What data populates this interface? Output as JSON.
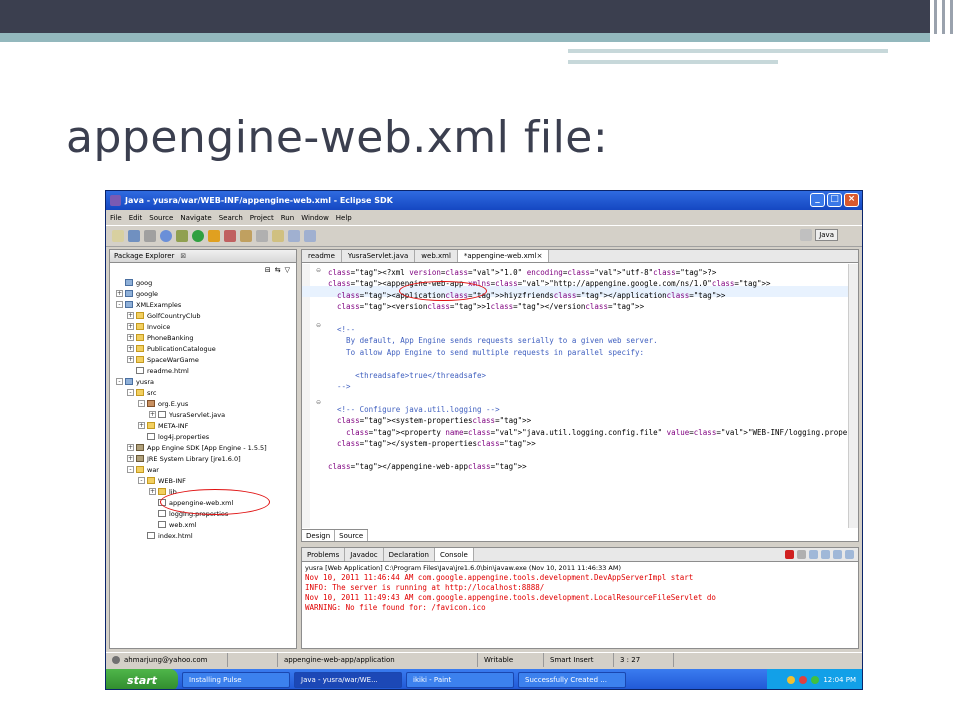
{
  "slide": {
    "title": "appengine-web.xml file:"
  },
  "window": {
    "title": "Java - yusra/war/WEB-INF/appengine-web.xml - Eclipse SDK",
    "menu": [
      "File",
      "Edit",
      "Source",
      "Navigate",
      "Search",
      "Project",
      "Run",
      "Window",
      "Help"
    ],
    "perspective": "Java"
  },
  "package_explorer": {
    "title": "Package Explorer",
    "items": [
      {
        "label": "goog",
        "icon": "proj",
        "depth": 0,
        "exp": ""
      },
      {
        "label": "google",
        "icon": "proj",
        "depth": 0,
        "exp": "+"
      },
      {
        "label": "XMLExamples",
        "icon": "proj",
        "depth": 0,
        "exp": "-"
      },
      {
        "label": "GolfCountryClub",
        "icon": "folder",
        "depth": 1,
        "exp": "+"
      },
      {
        "label": "Invoice",
        "icon": "folder",
        "depth": 1,
        "exp": "+"
      },
      {
        "label": "PhoneBanking",
        "icon": "folder",
        "depth": 1,
        "exp": "+"
      },
      {
        "label": "PublicationCatalogue",
        "icon": "folder",
        "depth": 1,
        "exp": "+"
      },
      {
        "label": "SpaceWarGame",
        "icon": "folder",
        "depth": 1,
        "exp": "+"
      },
      {
        "label": "readme.html",
        "icon": "file",
        "depth": 1,
        "exp": ""
      },
      {
        "label": "yusra",
        "icon": "proj",
        "depth": 0,
        "exp": "-"
      },
      {
        "label": "src",
        "icon": "folder",
        "depth": 1,
        "exp": "-"
      },
      {
        "label": "org.E.yus",
        "icon": "pkg",
        "depth": 2,
        "exp": "-"
      },
      {
        "label": "YusraServlet.java",
        "icon": "file",
        "depth": 3,
        "exp": "+"
      },
      {
        "label": "META-INF",
        "icon": "folder",
        "depth": 2,
        "exp": "+"
      },
      {
        "label": "log4j.properties",
        "icon": "file",
        "depth": 2,
        "exp": ""
      },
      {
        "label": "App Engine SDK [App Engine - 1.5.5]",
        "icon": "lib",
        "depth": 1,
        "exp": "+"
      },
      {
        "label": "JRE System Library [jre1.6.0]",
        "icon": "lib",
        "depth": 1,
        "exp": "+"
      },
      {
        "label": "war",
        "icon": "folder",
        "depth": 1,
        "exp": "-"
      },
      {
        "label": "WEB-INF",
        "icon": "folder",
        "depth": 2,
        "exp": "-"
      },
      {
        "label": "lib",
        "icon": "folder",
        "depth": 3,
        "exp": "+"
      },
      {
        "label": "appengine-web.xml",
        "icon": "file",
        "depth": 3,
        "exp": ""
      },
      {
        "label": "logging.properties",
        "icon": "file",
        "depth": 3,
        "exp": ""
      },
      {
        "label": "web.xml",
        "icon": "file",
        "depth": 3,
        "exp": ""
      },
      {
        "label": "index.html",
        "icon": "file",
        "depth": 2,
        "exp": ""
      }
    ]
  },
  "editor": {
    "tabs": [
      "readme",
      "YusraServlet.java",
      "web.xml",
      "*appengine-web.xml"
    ],
    "bottom_tabs": [
      "Design",
      "Source"
    ],
    "lines": [
      {
        "text": "<?xml version=\"1.0\" encoding=\"utf-8\"?>"
      },
      {
        "text": "<appengine-web-app xmlns=\"http://appengine.google.com/ns/1.0\">"
      },
      {
        "text": "  <application>hiyzfriends</application>"
      },
      {
        "text": "  <version>1</version>"
      },
      {
        "text": ""
      },
      {
        "text": "  <!--"
      },
      {
        "text": "    By default, App Engine sends requests serially to a given web server."
      },
      {
        "text": "    To allow App Engine to send multiple requests in parallel specify:"
      },
      {
        "text": ""
      },
      {
        "text": "      <threadsafe>true</threadsafe>"
      },
      {
        "text": "  -->"
      },
      {
        "text": ""
      },
      {
        "text": "  <!-- Configure java.util.logging -->"
      },
      {
        "text": "  <system-properties>"
      },
      {
        "text": "    <property name=\"java.util.logging.config.file\" value=\"WEB-INF/logging.properties\"/"
      },
      {
        "text": "  </system-properties>"
      },
      {
        "text": ""
      },
      {
        "text": "</appengine-web-app>"
      }
    ]
  },
  "console": {
    "tabs": [
      "Problems",
      "Javadoc",
      "Declaration",
      "Console"
    ],
    "header": "yusra [Web Application] C:\\Program Files\\Java\\jre1.6.0\\bin\\javaw.exe (Nov 10, 2011 11:46:33 AM)",
    "lines": [
      "Nov 10, 2011 11:46:44 AM com.google.appengine.tools.development.DevAppServerImpl start",
      "INFO: The server is running at http://localhost:8888/",
      "Nov 10, 2011 11:49:43 AM com.google.appengine.tools.development.LocalResourceFileServlet do",
      "WARNING: No file found for: /favicon.ico"
    ]
  },
  "statusbar": {
    "user": "ahmarjung@yahoo.com",
    "path": "appengine-web-app/application",
    "mode": "Writable",
    "insert": "Smart Insert",
    "position": "3 : 27"
  },
  "taskbar": {
    "start": "start",
    "tasks": [
      "Installing Pulse",
      "Java - yusra/war/WE...",
      "ikiki - Paint",
      "Successfully Created ..."
    ],
    "clock": "12:04 PM"
  }
}
